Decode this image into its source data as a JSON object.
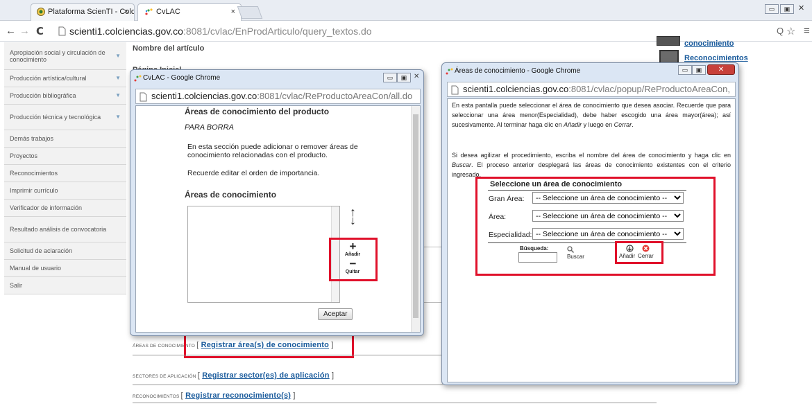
{
  "browser": {
    "tabs": [
      {
        "label": "Plataforma ScienTI - Colo",
        "active": false
      },
      {
        "label": "CvLAC",
        "active": true
      }
    ],
    "url_host": "scienti1.colciencias.gov.co",
    "url_path": ":8081/cvlac/EnProdArticulo/query_textos.do",
    "close_glyph": "×",
    "back_glyph": "←",
    "forward_glyph": "→",
    "reload_glyph": "C",
    "menu_glyph": "≡",
    "zoom_glyph": "Q",
    "star_glyph": "☆"
  },
  "sidebar": {
    "items": [
      {
        "label": "Apropiación social y circulación de conocimiento",
        "expandable": true
      },
      {
        "label": "Producción artística/cultural",
        "expandable": true
      },
      {
        "label": "Producción bibliográfica",
        "expandable": true
      },
      {
        "label": "Producción técnica y tecnológica",
        "expandable": true
      },
      {
        "label": "Demás trabajos",
        "expandable": false
      },
      {
        "label": "Proyectos",
        "expandable": false
      },
      {
        "label": "Reconocimientos",
        "expandable": false
      },
      {
        "label": "Imprimir currículo",
        "expandable": false
      },
      {
        "label": "Verificador de información",
        "expandable": false
      },
      {
        "label": "Resultado análisis de convocatoria",
        "expandable": false
      },
      {
        "label": "Solicitud de aclaración",
        "expandable": false
      },
      {
        "label": "Manual de usuario",
        "expandable": false
      },
      {
        "label": "Salir",
        "expandable": false
      }
    ]
  },
  "main": {
    "nombre_label": "Nombre del artículo",
    "pagina_label": "Página Inicial",
    "right_links": [
      "conocimiento",
      "Reconocimientos"
    ],
    "sections": [
      {
        "label": "ÁREAS DE CONOCIMIENTO",
        "open": "[ ",
        "link": "Registrar área(s) de conocimiento",
        "close": " ]"
      },
      {
        "label": "SECTORES DE APLICACIÓN",
        "open": "[ ",
        "link": "Registrar sector(es) de aplicación",
        "close": " ]"
      },
      {
        "label": "RECONOCIMIENTOS",
        "open": "[ ",
        "link": "Registrar reconocimiento(s)",
        "close": " ]"
      }
    ]
  },
  "popup1": {
    "title": "CvLAC - Google Chrome",
    "url_host": "scienti1.colciencias.gov.co",
    "url_path": ":8081/cvlac/ReProductoAreaCon/all.do",
    "heading": "Áreas de conocimiento del producto",
    "product_name": "PARA BORRA",
    "intro": "En esta sección puede adicionar o remover áreas de conocimiento relacionadas con el producto.",
    "reminder": "Recuerde editar el orden de importancia.",
    "subheading": "Áreas de conocimiento",
    "add_label": "Añadir",
    "remove_label": "Quitar",
    "add_glyph": "+",
    "remove_glyph": "−",
    "up_glyph": "↑",
    "down_glyph": "↓",
    "accept_label": "Aceptar"
  },
  "popup2": {
    "title": "Áreas de conocimiento - Google Chrome",
    "url_host": "scienti1.colciencias.gov.co",
    "url_path": ":8081/cvlac/popup/ReProductoAreaCon,",
    "para1_a": "En esta pantalla puede seleccionar el área de conocimiento que desea asociar. Recuerde que para seleccionar una área menor(Especialidad), debe haber escogido una área mayor(área); así sucesivamente. Al terminar haga clic en ",
    "para1_add": "Añadir",
    "para1_b": " y luego en ",
    "para1_close": "Cerrar",
    "para1_end": ".",
    "para2_a": "Si desea agilizar el procedimiento, escriba el nombre del área de conocimiento y haga clic en ",
    "para2_search": "Buscar",
    "para2_b": ". El proceso anterior desplegará las áreas de conocimiento existentes con el criterio ingresado.",
    "form_title": "Seleccione un área de conocimiento",
    "fields": [
      {
        "label": "Gran Área:",
        "value": "-- Seleccione un área de conocimiento --"
      },
      {
        "label": "Área:",
        "value": "-- Seleccione un área de conocimiento --"
      },
      {
        "label": "Especialidad:",
        "value": "-- Seleccione un área de conocimiento --"
      }
    ],
    "search_label": "Búsqueda:",
    "search_value": "",
    "search_button": "Buscar",
    "add_button": "Añadir",
    "close_button": "Cerrar"
  },
  "colors": {
    "highlight": "#e0102a",
    "link": "#1a5b9c"
  }
}
